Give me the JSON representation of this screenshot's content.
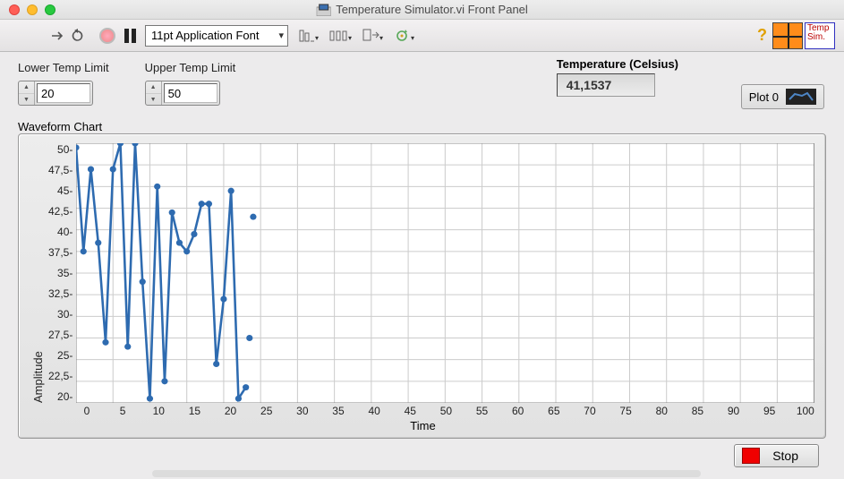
{
  "window": {
    "title": "Temperature Simulator.vi Front Panel",
    "temp_sim_label": "Temp\nSim."
  },
  "toolbar": {
    "font_label": "11pt Application Font"
  },
  "controls": {
    "lower_label": "Lower Temp Limit",
    "lower_value": "20",
    "upper_label": "Upper Temp Limit",
    "upper_value": "50"
  },
  "reading": {
    "label": "Temperature (Celsius)",
    "value": "41,1537"
  },
  "legend": {
    "label": "Plot 0"
  },
  "chart": {
    "title": "Waveform Chart",
    "ylabel": "Amplitude",
    "xlabel": "Time",
    "yticks": [
      "50",
      "47,5",
      "45",
      "42,5",
      "40",
      "37,5",
      "35",
      "32,5",
      "30",
      "27,5",
      "25",
      "22,5",
      "20"
    ],
    "xticks": [
      "0",
      "5",
      "10",
      "15",
      "20",
      "25",
      "30",
      "35",
      "40",
      "45",
      "50",
      "55",
      "60",
      "65",
      "70",
      "75",
      "80",
      "85",
      "90",
      "95",
      "100"
    ]
  },
  "chart_data": {
    "type": "line",
    "title": "Waveform Chart",
    "xlabel": "Time",
    "ylabel": "Amplitude",
    "xlim": [
      0,
      100
    ],
    "ylim": [
      20,
      50
    ],
    "series": [
      {
        "name": "Plot 0",
        "color": "#2e6bb0",
        "x": [
          0,
          1,
          2,
          3,
          4,
          5,
          6,
          7,
          8,
          9,
          10,
          11,
          12,
          13,
          14,
          15,
          16,
          17,
          18,
          19,
          20,
          21,
          22,
          23
        ],
        "y": [
          49.5,
          37.5,
          47.0,
          38.5,
          27.0,
          47.0,
          50.0,
          26.5,
          50.0,
          34.0,
          20.5,
          45.0,
          22.5,
          42.0,
          38.5,
          37.5,
          39.5,
          43.0,
          43.0,
          24.5,
          32.0,
          44.5,
          20.5,
          21.8
        ]
      }
    ],
    "annotations": [
      {
        "x": 23.5,
        "y": 27.5
      },
      {
        "x": 24,
        "y": 41.5
      }
    ]
  },
  "buttons": {
    "stop": "Stop"
  }
}
